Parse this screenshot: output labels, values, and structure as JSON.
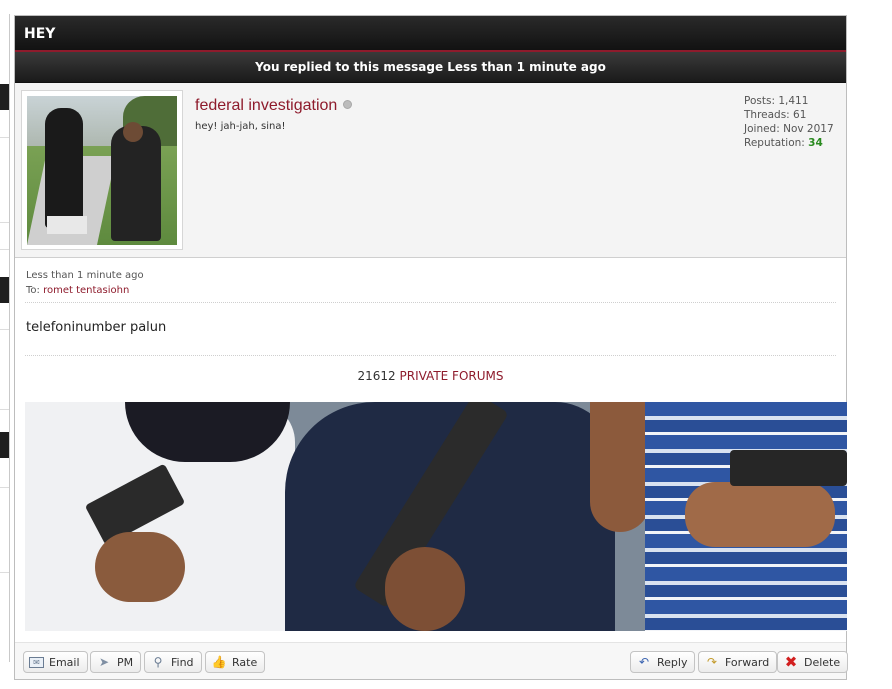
{
  "panel": {
    "title": "HEY",
    "reply_notice": "You replied to this message Less than 1 minute ago"
  },
  "author": {
    "username": "federal investigation",
    "status": "offline",
    "user_title": "hey! jah-jah, sina!",
    "stats": {
      "posts": "Posts: 1,411",
      "threads": "Threads: 61",
      "joined": "Joined: Nov 2017",
      "reputation_label": "Reputation: ",
      "reputation_value": "34"
    }
  },
  "message": {
    "time": "Less than 1 minute ago",
    "to_label": "To: ",
    "to_name": "romet tentasiohn",
    "body": "telefoninumber palun"
  },
  "signature": {
    "count": "21612",
    "link_text": "PRIVATE FORUMS"
  },
  "toolbar": {
    "email": "Email",
    "pm": "PM",
    "find": "Find",
    "rate": "Rate",
    "reply": "Reply",
    "forward": "Forward",
    "delete": "Delete"
  },
  "icons": {
    "email": "envelope-icon",
    "pm": "paper-plane-icon",
    "find": "magnifier-icon",
    "rate": "thumbs-up-icon",
    "reply": "reply-icon",
    "forward": "forward-icon",
    "delete": "x-icon"
  },
  "colors": {
    "accent": "#8e1b2c",
    "header_bg": "#1a1a1a",
    "reputation": "#2a8a1f",
    "delete": "#d21f1f"
  }
}
